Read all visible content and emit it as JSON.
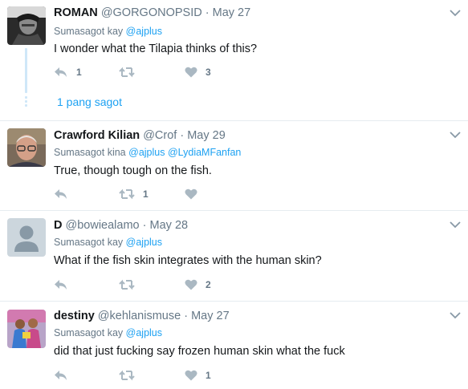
{
  "tweets": [
    {
      "name": "ROMAN",
      "handle": "@GORGONOPSID",
      "date": "May 27",
      "reply_prefix": "Sumasagot kay",
      "reply_mentions": "@ajplus",
      "text": "I wonder what the Tilapia thinks of this?",
      "reply_count": "1",
      "retweet_count": "",
      "like_count": "3"
    },
    {
      "name": "Crawford Kilian",
      "handle": "@Crof",
      "date": "May 29",
      "reply_prefix": "Sumasagot kina",
      "reply_mentions": "@ajplus @LydiaMFanfan",
      "text": "True, though tough on the fish.",
      "reply_count": "",
      "retweet_count": "1",
      "like_count": ""
    },
    {
      "name": "D",
      "handle": "@bowiealamo",
      "date": "May 28",
      "reply_prefix": "Sumasagot kay",
      "reply_mentions": "@ajplus",
      "text": "What if the fish skin integrates with the human skin?",
      "reply_count": "",
      "retweet_count": "",
      "like_count": "2"
    },
    {
      "name": "destiny",
      "handle": "@kehlanismuse",
      "date": "May 27",
      "reply_prefix": "Sumasagot kay",
      "reply_mentions": "@ajplus",
      "text": "did that just fucking say frozen human skin what the fuck",
      "reply_count": "",
      "retweet_count": "",
      "like_count": "1"
    }
  ],
  "thread": {
    "more_replies_label": "1 pang sagot"
  },
  "separator": "·",
  "colors": {
    "link": "#1da1f2",
    "muted": "#657786",
    "icon": "#aab8c2",
    "thread_line": "#cfe7f8",
    "divider": "#e6ecf0"
  },
  "icons": [
    "reply-icon",
    "retweet-icon",
    "heart-icon",
    "chevron-down-icon"
  ]
}
